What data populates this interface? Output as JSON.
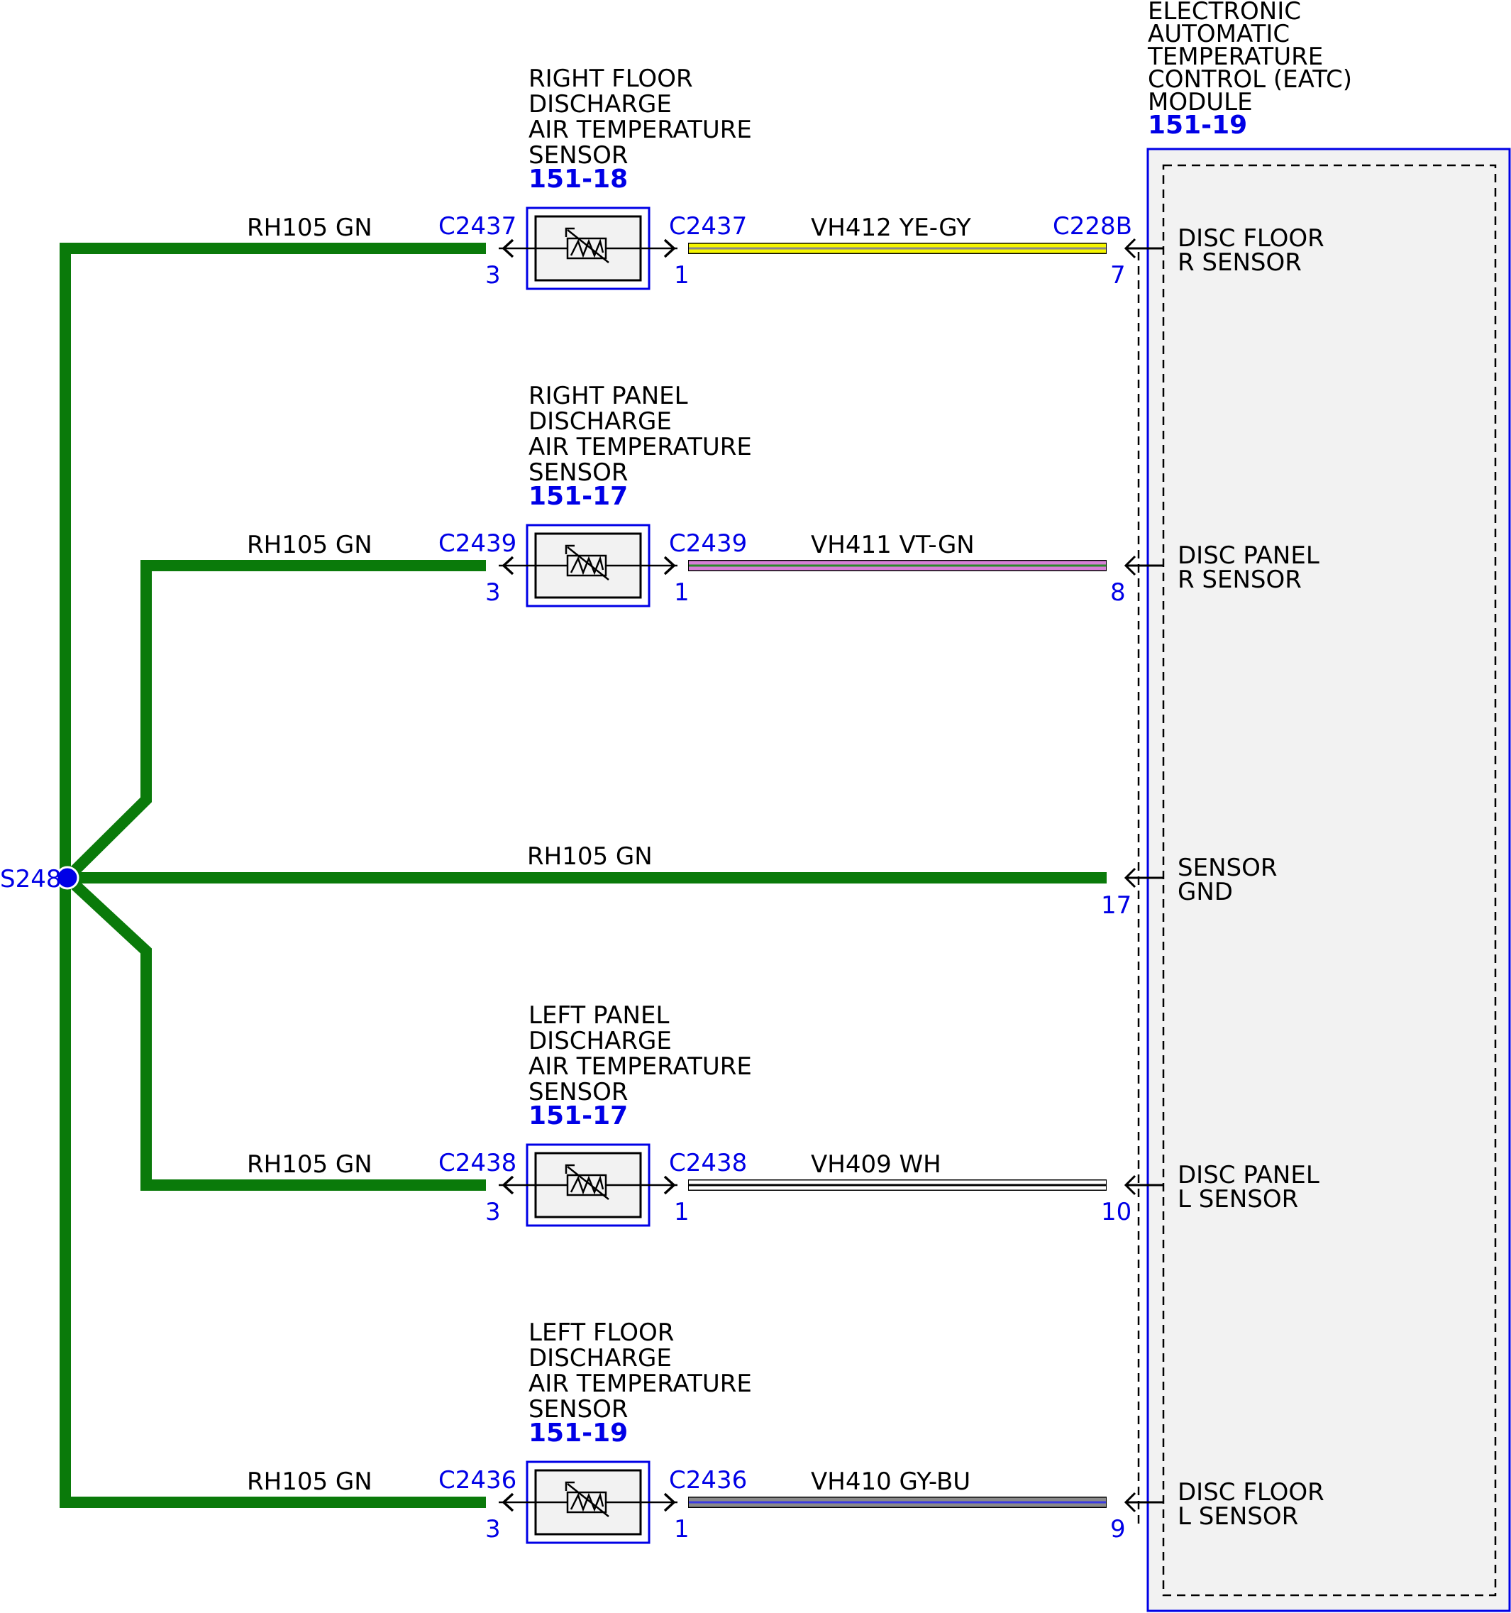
{
  "colors": {
    "connector_blue": "#0000e6",
    "ground_wire_green": "#0a7a0a",
    "module_fill": "#f2f2f2",
    "sensor_fill": "#f2f2f2",
    "wire_ye_gy": [
      "#f5f500",
      "#888888"
    ],
    "wire_vt_gn": [
      "#d77fd7",
      "#2a8a2a"
    ],
    "wire_wh": [
      "#ffffff",
      "#000000"
    ],
    "wire_gy_bu": [
      "#8a8a8a",
      "#3a3ae0"
    ]
  },
  "module": {
    "title_lines": [
      "ELECTRONIC",
      "AUTOMATIC",
      "TEMPERATURE",
      "CONTROL (EATC)",
      "MODULE"
    ],
    "ref": "151-19",
    "pins": [
      {
        "name_lines": [
          "DISC FLOOR",
          "R SENSOR"
        ],
        "pin": "7",
        "connector": "C228B"
      },
      {
        "name_lines": [
          "DISC PANEL",
          "R SENSOR"
        ],
        "pin": "8",
        "connector": ""
      },
      {
        "name_lines": [
          "SENSOR",
          "GND"
        ],
        "pin": "17",
        "connector": ""
      },
      {
        "name_lines": [
          "DISC PANEL",
          "L SENSOR"
        ],
        "pin": "10",
        "connector": ""
      },
      {
        "name_lines": [
          "DISC FLOOR",
          "L SENSOR"
        ],
        "pin": "9",
        "connector": ""
      }
    ]
  },
  "splice": {
    "label": "S248"
  },
  "ground_circuit": {
    "label": "RH105  GN"
  },
  "sensors": [
    {
      "name_lines": [
        "RIGHT FLOOR",
        "DISCHARGE",
        "AIR TEMPERATURE",
        "SENSOR"
      ],
      "ref": "151-18",
      "connector": "C2437",
      "pin_left": "3",
      "pin_right": "1",
      "ground_wire_label": "RH105  GN",
      "signal_wire_label": "VH412  YE-GY",
      "signal_wire_icon": "wire-ye-gy-icon"
    },
    {
      "name_lines": [
        "RIGHT PANEL",
        "DISCHARGE",
        "AIR TEMPERATURE",
        "SENSOR"
      ],
      "ref": "151-17",
      "connector": "C2439",
      "pin_left": "3",
      "pin_right": "1",
      "ground_wire_label": "RH105  GN",
      "signal_wire_label": "VH411  VT-GN",
      "signal_wire_icon": "wire-vt-gn-icon"
    },
    {
      "name_lines": [
        "LEFT PANEL",
        "DISCHARGE",
        "AIR TEMPERATURE",
        "SENSOR"
      ],
      "ref": "151-17",
      "connector": "C2438",
      "pin_left": "3",
      "pin_right": "1",
      "ground_wire_label": "RH105  GN",
      "signal_wire_label": "VH409  WH",
      "signal_wire_icon": "wire-wh-icon"
    },
    {
      "name_lines": [
        "LEFT FLOOR",
        "DISCHARGE",
        "AIR TEMPERATURE",
        "SENSOR"
      ],
      "ref": "151-19",
      "connector": "C2436",
      "pin_left": "3",
      "pin_right": "1",
      "ground_wire_label": "RH105  GN",
      "signal_wire_label": "VH410  GY-BU",
      "signal_wire_icon": "wire-gy-bu-icon"
    }
  ]
}
